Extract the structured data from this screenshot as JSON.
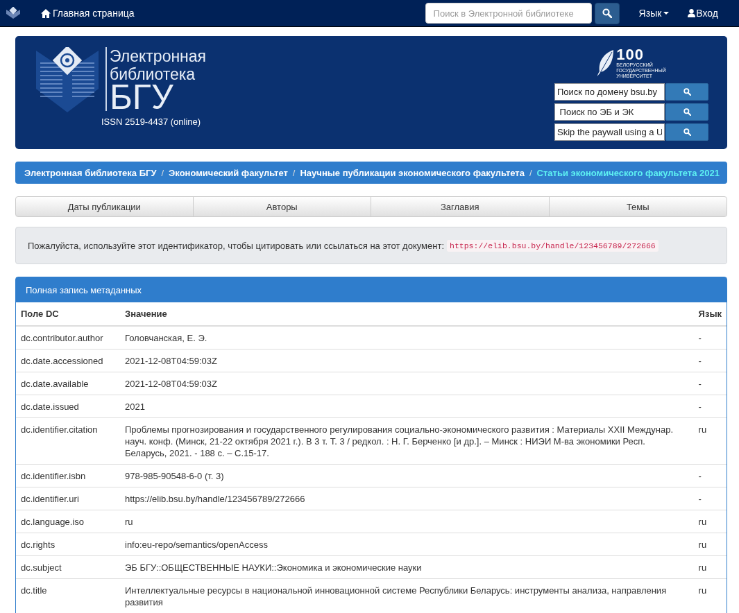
{
  "navbar": {
    "home": "Главная страница",
    "search": {
      "placeholder": "Поиск в Электронной библиотеке"
    },
    "language": "Язык",
    "login": "Вход"
  },
  "header": {
    "logo_lines": [
      "Электронная",
      "библиотека",
      "БГУ"
    ],
    "issn": "ISSN 2519-4437 (online)",
    "university": {
      "number": "100",
      "lines": [
        "БЕЛОРУССКИЙ",
        "ГОСУДАРСТВЕННЫЙ",
        "УНИВЕРСИТЕТ"
      ]
    },
    "searches": [
      {
        "value": "Поиск по домену bsu.by"
      },
      {
        "value": " Поиск по ЭБ и ЭК"
      },
      {
        "value": "Skip the paywall using a U"
      }
    ]
  },
  "breadcrumb_separator": "/",
  "breadcrumb": [
    {
      "label": "Электронная библиотека БГУ",
      "selected": false
    },
    {
      "label": "Экономический факультет",
      "selected": false
    },
    {
      "label": "Научные публикации экономического факультета",
      "selected": false
    },
    {
      "label": "Статьи экономического факультета 2021",
      "selected": true
    }
  ],
  "browse_tabs": [
    "Даты публикации",
    "Авторы",
    "Заглавия",
    "Темы"
  ],
  "citation": {
    "text": "Пожалуйста, используйте этот идентификатор, чтобы цитировать или ссылаться на этот документ:",
    "handle": "https://elib.bsu.by/handle/123456789/272666"
  },
  "metadata": {
    "title": "Полная запись метаданных",
    "columns": [
      "Поле DC",
      "Значение",
      "Язык"
    ],
    "rows": [
      [
        "dc.contributor.author",
        "Головчанская, Е. Э.",
        "-"
      ],
      [
        "dc.date.accessioned",
        "2021-12-08T04:59:03Z",
        "-"
      ],
      [
        "dc.date.available",
        "2021-12-08T04:59:03Z",
        "-"
      ],
      [
        "dc.date.issued",
        "2021",
        "-"
      ],
      [
        "dc.identifier.citation",
        "Проблемы прогнозирования и государственного регулирования социально-экономического развития : Материалы XXII Междунар. науч. конф. (Минск, 21-22 октября 2021 г.). В 3 т. Т. 3 / редкол. : Н. Г. Берченко [и др.]. – Минск : НИЭИ М-ва экономики Респ. Беларусь, 2021. - 188 с. – С.15-17.",
        "ru"
      ],
      [
        "dc.identifier.isbn",
        "978-985-90548-6-0 (т. 3)",
        "-"
      ],
      [
        "dc.identifier.uri",
        "https://elib.bsu.by/handle/123456789/272666",
        "-"
      ],
      [
        "dc.language.iso",
        "ru",
        "ru"
      ],
      [
        "dc.rights",
        "info:eu-repo/semantics/openAccess",
        "ru"
      ],
      [
        "dc.subject",
        "ЭБ БГУ::ОБЩЕСТВЕННЫЕ НАУКИ::Экономика и экономические науки",
        "ru"
      ],
      [
        "dc.title",
        "Интеллектуальные ресурсы в национальной инновационной системе Республики Беларусь: инструменты анализа, направления развития",
        "ru"
      ]
    ]
  }
}
